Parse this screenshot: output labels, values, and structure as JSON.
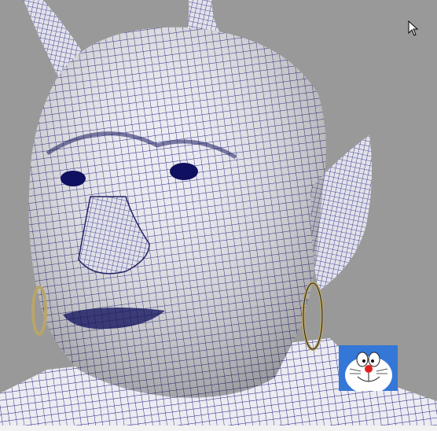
{
  "viewport": {
    "subject": "wireframe-mesh-head",
    "background_color": "#999999",
    "mesh_line_color": "#1a1a7a",
    "skin_color": "#e8e8ee",
    "earring_color": "#b8a56a"
  },
  "overlay": {
    "thumbnail_icon": "cartoon-cat-face-icon"
  },
  "cursor": {
    "icon": "arrow-cursor-icon"
  }
}
